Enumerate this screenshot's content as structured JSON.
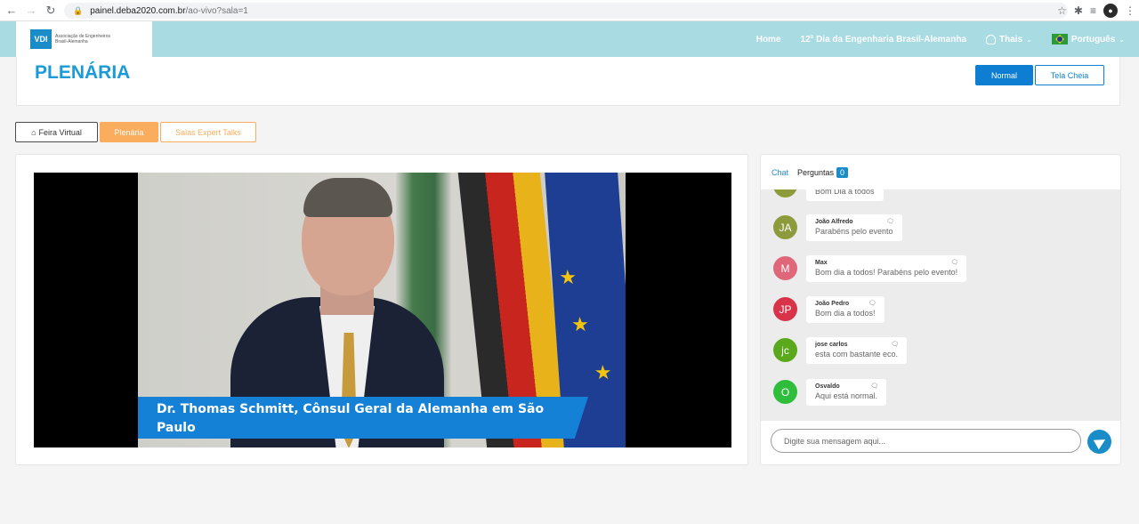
{
  "browser": {
    "url_domain": "painel.deba2020.com.br",
    "url_path": "/ao-vivo?sala=1"
  },
  "header": {
    "logo_mark": "VDI",
    "logo_text_1": "Associação de Engenheiros",
    "logo_text_2": "Brasil-Alemanha",
    "nav": {
      "home": "Home",
      "event": "12º Dia da Engenharia Brasil-Alemanha",
      "user": "Thais",
      "language": "Português"
    }
  },
  "page": {
    "title": "PLENÁRIA",
    "view_normal": "Normal",
    "view_full": "Tela Cheia"
  },
  "tabs": {
    "feira": "Feira Virtual",
    "plenaria": "Plenária",
    "salas": "Salas Expert Talks"
  },
  "video": {
    "caption": "Dr. Thomas Schmitt, Cônsul Geral da Alemanha em São Paulo"
  },
  "chat": {
    "tab_chat": "Chat",
    "tab_questions": "Perguntas",
    "questions_count": "0",
    "partial_message": "Bom Dia a todos",
    "messages": [
      {
        "initials": "JA",
        "name": "João Alfredo",
        "text": "Parabéns pelo evento",
        "color": "#8e9b3c"
      },
      {
        "initials": "M",
        "name": "Max",
        "text": "Bom dia a todos! Parabéns pelo evento!",
        "color": "#e0667a"
      },
      {
        "initials": "JP",
        "name": "João Pedro",
        "text": "Bom dia a todos!",
        "color": "#d9334a"
      },
      {
        "initials": "jc",
        "name": "jose carlos",
        "text": "esta com bastante eco.",
        "color": "#5aa81c"
      },
      {
        "initials": "O",
        "name": "Osvaldo",
        "text": "Aqui está normal.",
        "color": "#2fbd3c"
      }
    ],
    "input_placeholder": "Digite sua mensagem aqui..."
  },
  "colors": {
    "brand_blue": "#1a9bd7",
    "header_bg": "#a8dbe2",
    "tab_orange": "#f9ad5d"
  }
}
